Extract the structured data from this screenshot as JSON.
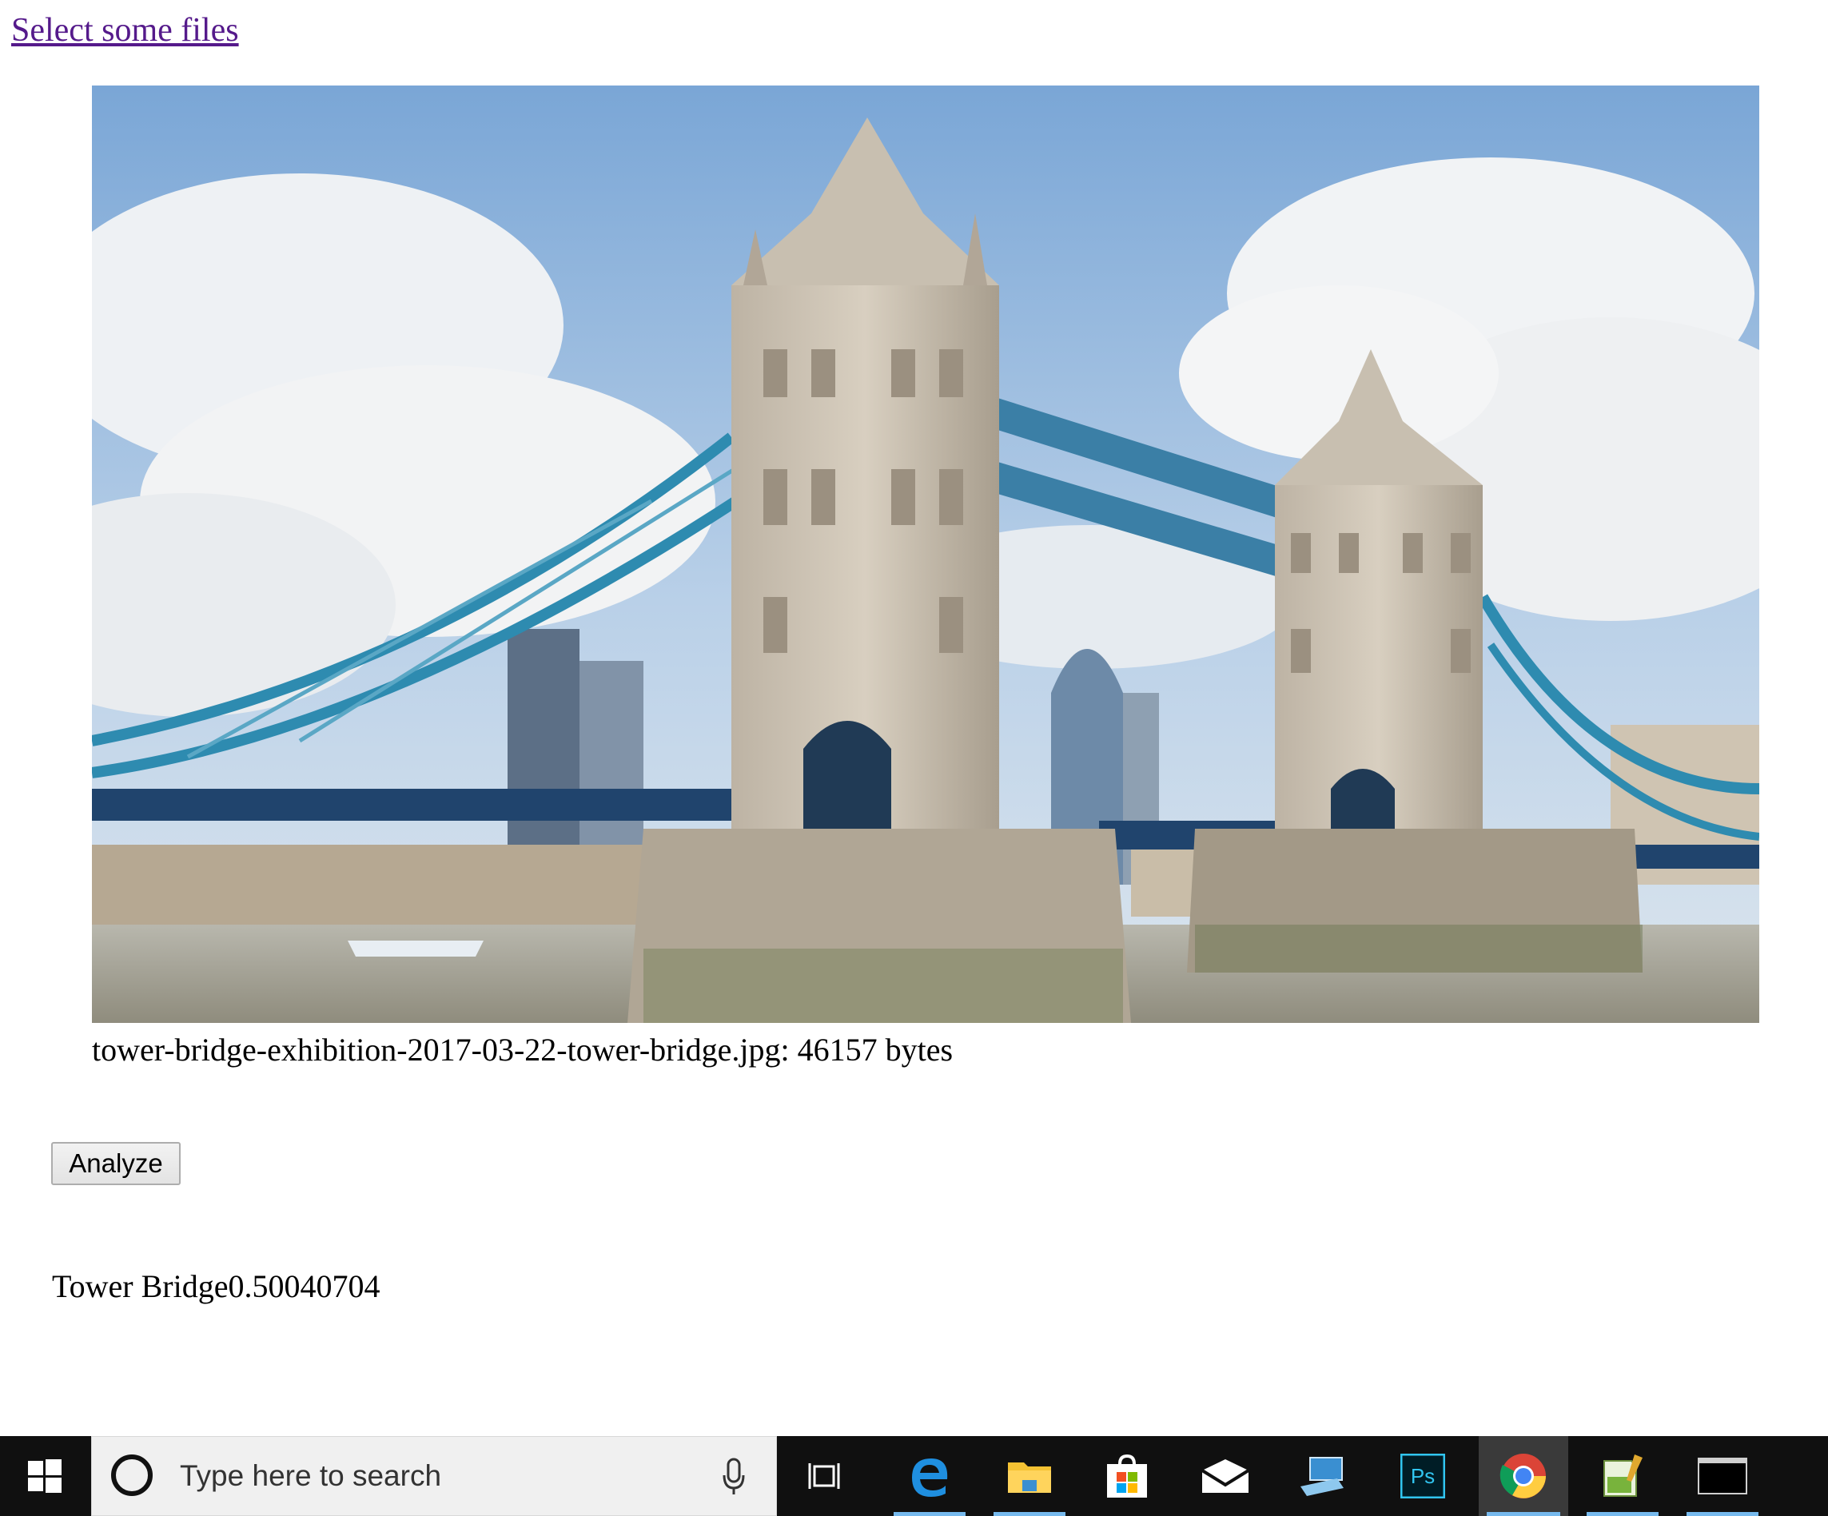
{
  "page": {
    "select_link": "Select some files",
    "file_caption": "tower-bridge-exhibition-2017-03-22-tower-bridge.jpg: 46157 bytes",
    "analyze_label": "Analyze",
    "result_text": "Tower Bridge0.50040704"
  },
  "taskbar": {
    "search_placeholder": "Type here to search",
    "icons": [
      "windows-start-icon",
      "cortana-icon",
      "microphone-icon",
      "task-view-icon",
      "edge-icon",
      "file-explorer-icon",
      "store-icon",
      "mail-icon",
      "remote-desktop-icon",
      "photoshop-icon",
      "chrome-icon",
      "notepad-app-icon",
      "terminal-icon"
    ],
    "photoshop_label": "Ps",
    "accent": "#76b9ed"
  },
  "colors": {
    "link": "#551a8b",
    "taskbar_bg": "#101010",
    "sky": "#8fb4dc",
    "bridge_blue": "#2e8bb0"
  }
}
